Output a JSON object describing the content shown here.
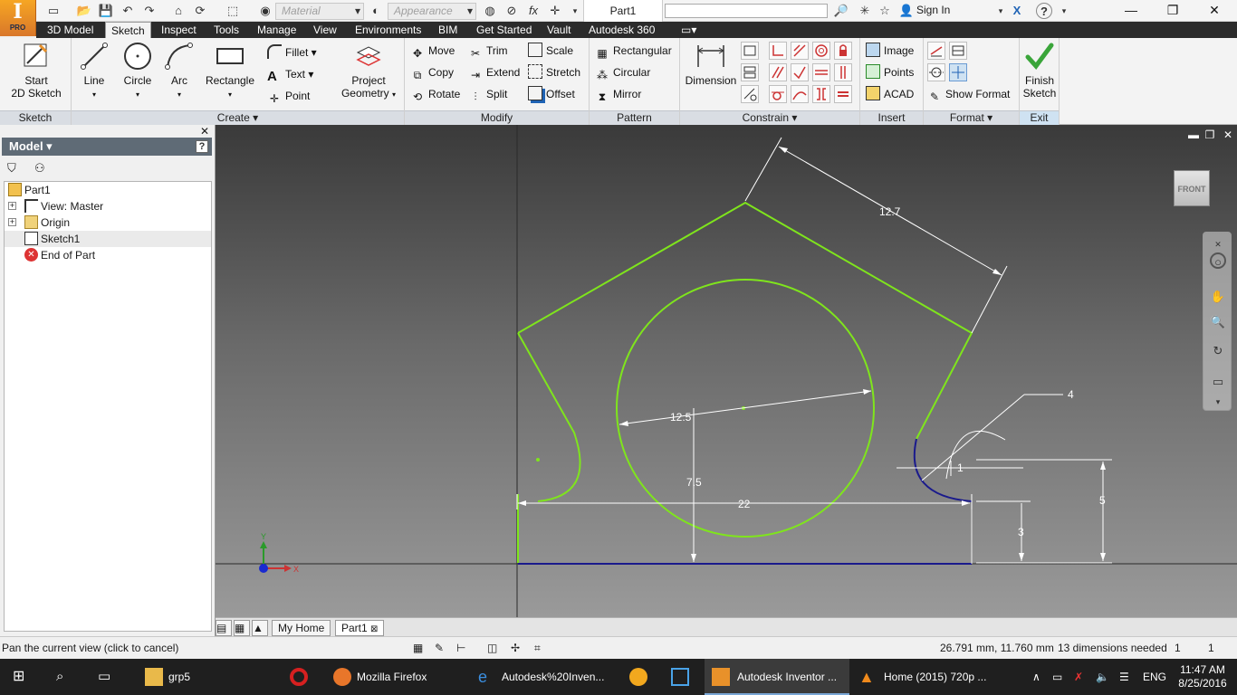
{
  "qat": {
    "material_placeholder": "Material",
    "appearance_placeholder": "Appearance",
    "fx": "fx",
    "document_title": "Part1",
    "sign_in": "Sign In",
    "help": "?"
  },
  "logo": {
    "letter": "I",
    "edition": "PRO"
  },
  "menu_tabs": [
    "3D Model",
    "Sketch",
    "Inspect",
    "Tools",
    "Manage",
    "View",
    "Environments",
    "BIM",
    "Get Started",
    "Vault",
    "Autodesk 360"
  ],
  "ribbon": {
    "sketch_panel": {
      "start_line1": "Start",
      "start_line2": "2D Sketch",
      "label": "Sketch"
    },
    "create_panel": {
      "line": "Line",
      "circle": "Circle",
      "arc": "Arc",
      "rectangle": "Rectangle",
      "fillet": "Fillet",
      "text": "Text",
      "point": "Point",
      "project_line1": "Project",
      "project_line2": "Geometry",
      "label": "Create"
    },
    "modify_panel": {
      "move": "Move",
      "trim": "Trim",
      "scale": "Scale",
      "copy": "Copy",
      "extend": "Extend",
      "stretch": "Stretch",
      "rotate": "Rotate",
      "split": "Split",
      "offset": "Offset",
      "label": "Modify"
    },
    "pattern_panel": {
      "rectangular": "Rectangular",
      "circular": "Circular",
      "mirror": "Mirror",
      "label": "Pattern"
    },
    "constrain_panel": {
      "dimension": "Dimension",
      "label": "Constrain"
    },
    "insert_panel": {
      "image": "Image",
      "points": "Points",
      "acad": "ACAD",
      "label": "Insert"
    },
    "format_panel": {
      "show_format": "Show Format",
      "label": "Format"
    },
    "exit_panel": {
      "finish_line1": "Finish",
      "finish_line2": "Sketch",
      "label": "Exit"
    }
  },
  "browser": {
    "title": "Model",
    "help": "?",
    "tree": [
      {
        "label": "Part1"
      },
      {
        "label": "View: Master"
      },
      {
        "label": "Origin"
      },
      {
        "label": "Sketch1"
      },
      {
        "label": "End of Part"
      }
    ]
  },
  "graphics": {
    "viewcube_label": "FRONT",
    "dimensions": {
      "d_side": "12.7",
      "d_circle": "12.5",
      "d_height": "7.5",
      "d_width": "22",
      "d_arc": "4",
      "d_offset": "1",
      "d_right_height": "5",
      "d_step": "3"
    },
    "axes": {
      "x": "X",
      "y": "Y"
    }
  },
  "doc_tabs": {
    "home": "My Home",
    "part": "Part1"
  },
  "status": {
    "message": "Pan the current view (click to cancel)",
    "coords": "26.791 mm, 11.760 mm",
    "dims_needed": "13 dimensions needed",
    "count1": "1",
    "count2": "1"
  },
  "taskbar": {
    "items": [
      "grp5",
      "Mozilla Firefox",
      "Autodesk%20Inven...",
      "Autodesk Inventor ...",
      "Home (2015) 720p ..."
    ],
    "lang": "ENG",
    "time": "11:47 AM",
    "date": "8/25/2016"
  },
  "colors": {
    "sketch_green": "#7fe51c",
    "constraint_blue": "#1a1a8c",
    "dimension_white": "#ffffff",
    "accent_orange": "#e8912a"
  }
}
